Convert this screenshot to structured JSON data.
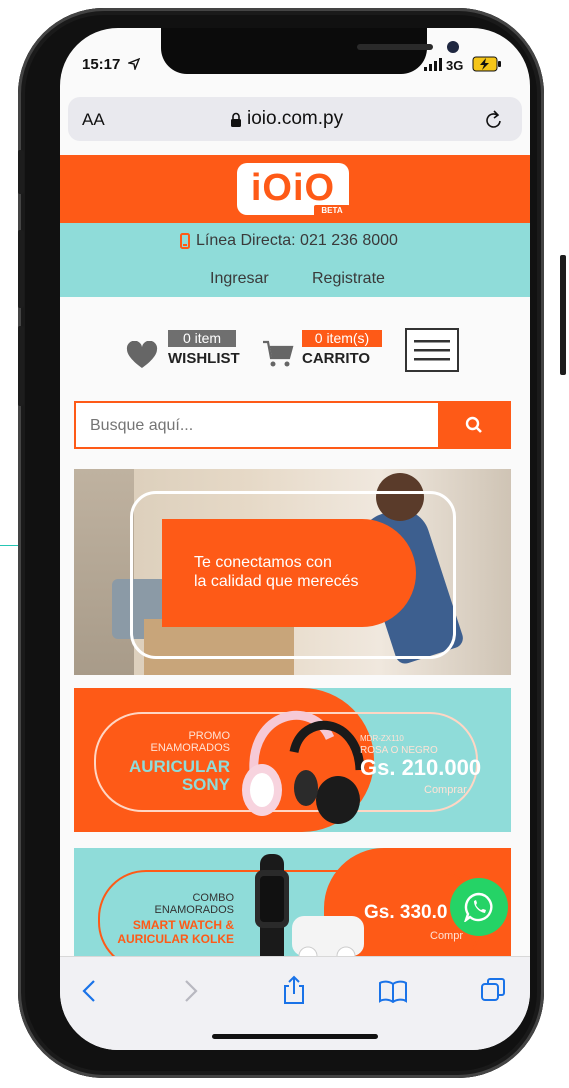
{
  "status_bar": {
    "time": "15:17",
    "network": "3G"
  },
  "browser": {
    "text_size_label": "AA",
    "url": "ioio.com.py"
  },
  "site": {
    "logo_text": "iOiO",
    "logo_badge": "BETA",
    "hotline": "Línea Directa: 021 236 8000",
    "login": "Ingresar",
    "register": "Registrate",
    "wishlist_count": "0 item",
    "wishlist_label": "WISHLIST",
    "cart_count": "0 item(s)",
    "cart_label": "CARRITO",
    "search_placeholder": "Busque aquí..."
  },
  "banners": {
    "hero_line1": "Te conectamos con",
    "hero_line2": "la calidad que merecés",
    "b2_promo1": "PROMO",
    "b2_promo2": "ENAMORADOS",
    "b2_title1": "AURICULAR",
    "b2_title2": "SONY",
    "b2_model": "MDR-ZX110",
    "b2_colors": "ROSA O NEGRO",
    "b2_price": "Gs. 210.000",
    "b2_cta": "Comprar",
    "b3_combo1": "COMBO",
    "b3_combo2": "ENAMORADOS",
    "b3_title1": "SMART WATCH &",
    "b3_title2": "AURICULAR KOLKE",
    "b3_price": "Gs. 330.0",
    "b3_cta": "Compr"
  },
  "colors": {
    "brand_orange": "#fe5a17",
    "teal": "#8fdcd9",
    "whatsapp_green": "#25d366"
  },
  "icons": [
    "location-arrow-icon",
    "signal-icon",
    "battery-charging-icon",
    "lock-icon",
    "reload-icon",
    "phone-icon",
    "heart-icon",
    "cart-icon",
    "menu-icon",
    "search-icon",
    "whatsapp-icon",
    "back-icon",
    "forward-icon",
    "share-icon",
    "bookmarks-icon",
    "tabs-icon"
  ]
}
